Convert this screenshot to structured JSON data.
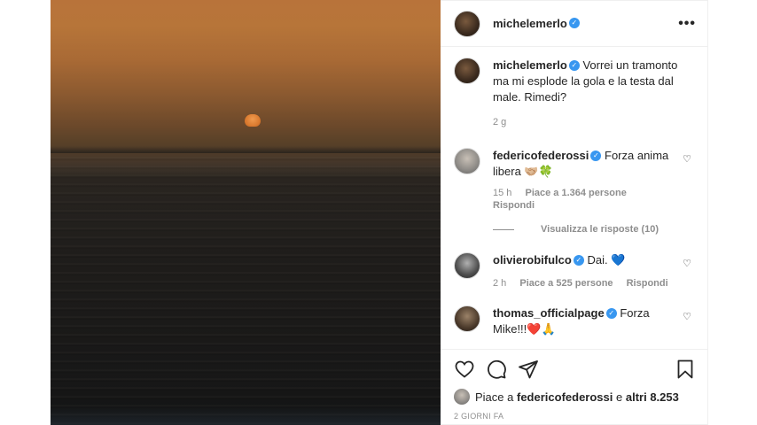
{
  "post": {
    "author": "michelemerlo",
    "more_label": "•••"
  },
  "caption": {
    "author": "michelemerlo",
    "text": "Vorrei un tramonto ma mi esplode la gola e la testa dal male. Rimedi?",
    "time": "2 g"
  },
  "comments": [
    {
      "author": "federicofederossi",
      "text": "Forza anima libera 🤝🏼🍀",
      "time": "15 h",
      "likes": "Piace a 1.364 persone",
      "reply": "Rispondi",
      "view_replies": "Visualizza le risposte (10)"
    },
    {
      "author": "olivierobifulco",
      "text": "Dai. 💙",
      "time": "2 h",
      "likes": "Piace a 525 persone",
      "reply": "Rispondi"
    },
    {
      "author": "thomas_officialpage",
      "text": "Forza Mike!!!❤️🙏",
      "time": "",
      "likes": "",
      "reply": ""
    }
  ],
  "likes_summary": {
    "prefix": "Piace a",
    "user": "federicofederossi",
    "connector": "e",
    "others": "altri 8.253"
  },
  "date": "2 GIORNI FA",
  "icons": {
    "verified": "verified-badge-icon",
    "like": "heart-icon",
    "comment": "comment-icon",
    "share": "paper-plane-icon",
    "save": "bookmark-icon"
  }
}
